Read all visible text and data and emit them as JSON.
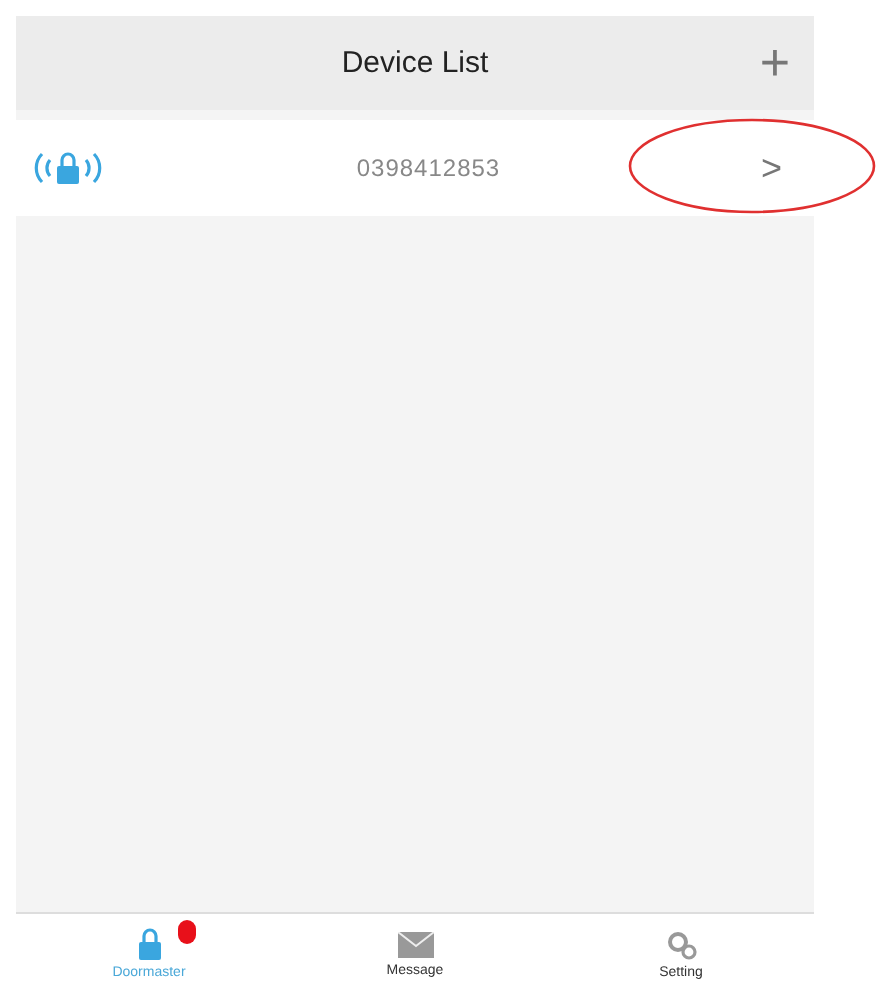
{
  "header": {
    "title": "Device List",
    "add_symbol": "+"
  },
  "devices": [
    {
      "id_text": "0398412853",
      "chevron": ">",
      "highlighted": true
    }
  ],
  "tabs": [
    {
      "label": "Doormaster",
      "selected": true,
      "badge": true,
      "kind": "lock"
    },
    {
      "label": "Message",
      "selected": false,
      "badge": false,
      "kind": "mail"
    },
    {
      "label": "Setting",
      "selected": false,
      "badge": false,
      "kind": "gears"
    }
  ]
}
